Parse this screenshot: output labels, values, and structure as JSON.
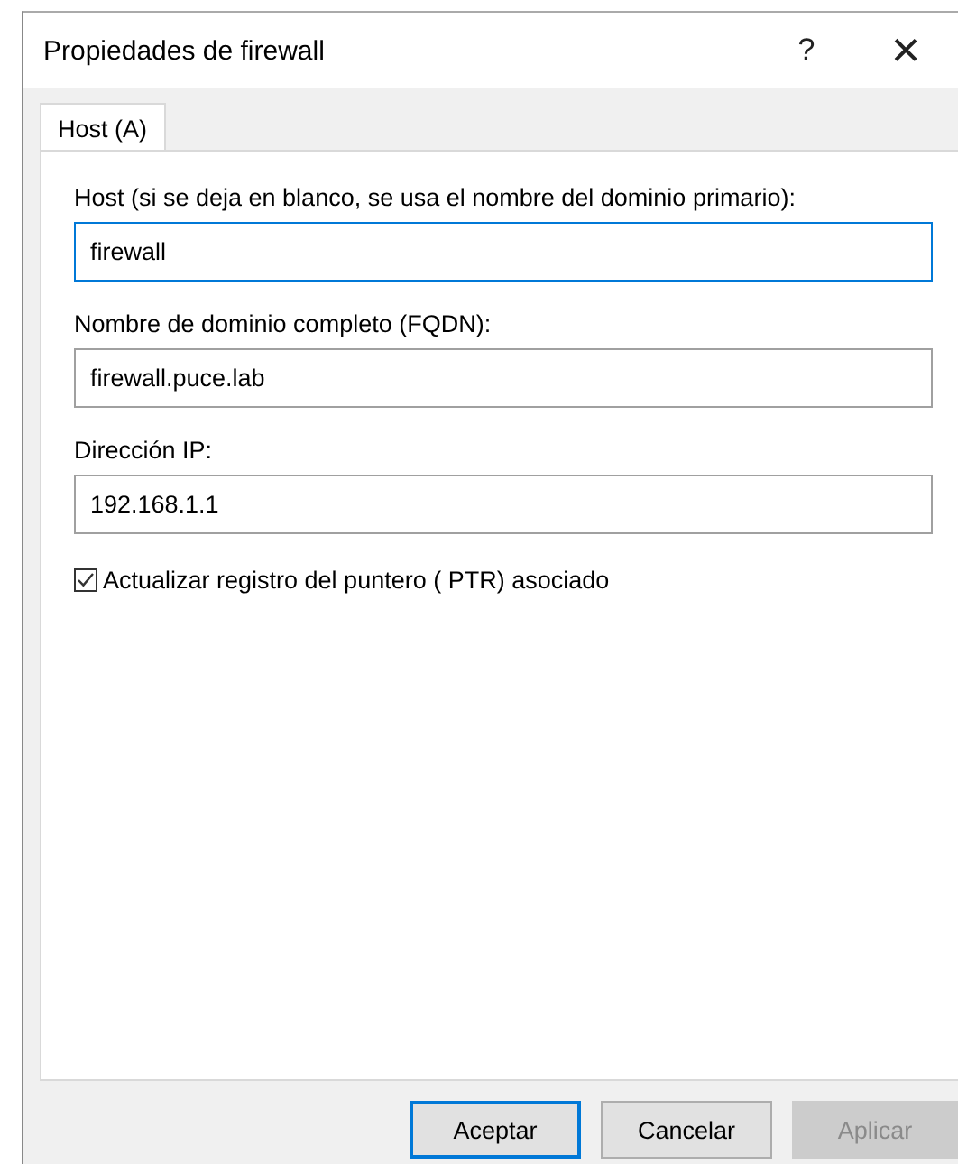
{
  "window": {
    "title": "Propiedades de firewall",
    "help_glyph": "?",
    "close_glyph": "×"
  },
  "tabs": [
    {
      "label": "Host (A)",
      "selected": true
    }
  ],
  "fields": [
    {
      "label": "Host (si se deja en blanco, se usa el nombre del dominio primario):",
      "value": "firewall",
      "focused": true
    },
    {
      "label": "Nombre de dominio completo (FQDN):",
      "value": "firewall.puce.lab",
      "focused": false
    },
    {
      "label": "Dirección IP:",
      "value": "192.168.1.1",
      "focused": false
    }
  ],
  "checkbox": {
    "label": "Actualizar registro del puntero ( PTR) asociado",
    "checked": true
  },
  "buttons": [
    {
      "label": "Aceptar",
      "default": true,
      "disabled": false
    },
    {
      "label": "Cancelar",
      "default": false,
      "disabled": false
    },
    {
      "label": "Aplicar",
      "default": false,
      "disabled": true
    }
  ]
}
